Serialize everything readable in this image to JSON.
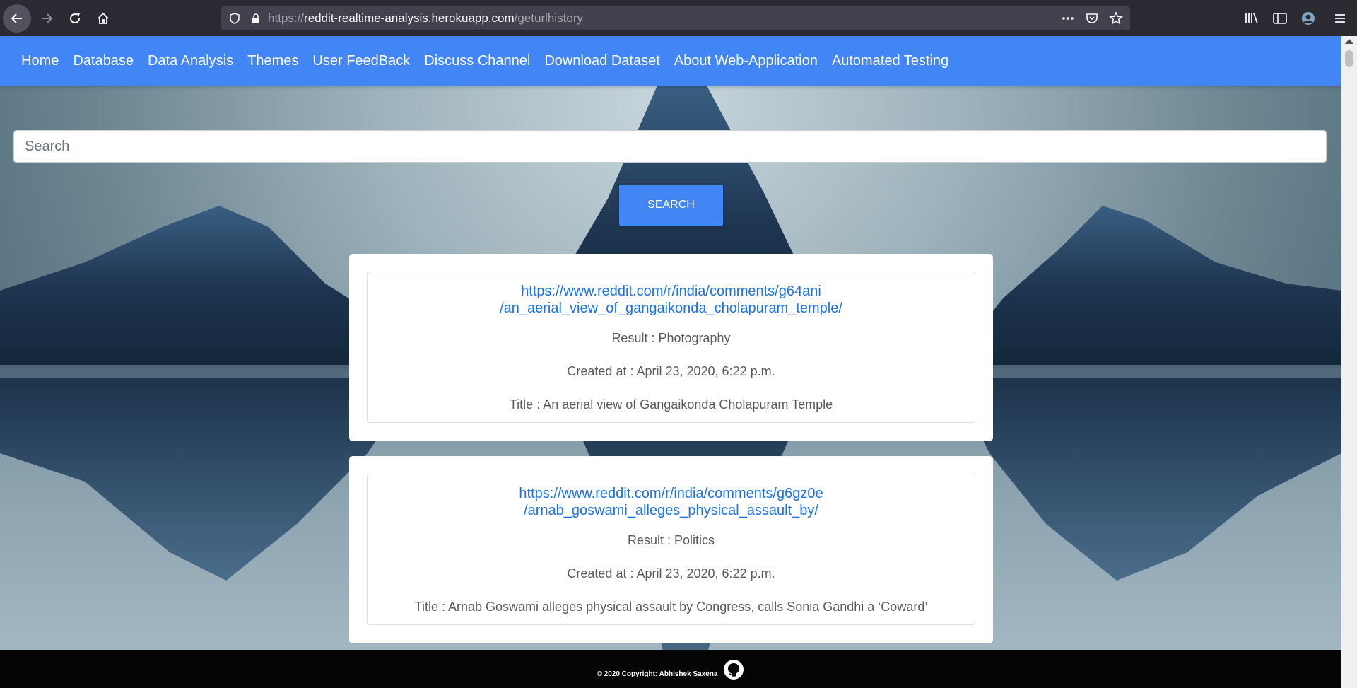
{
  "browser": {
    "url_protocol": "https://",
    "url_domain": "reddit-realtime-analysis.herokuapp.com",
    "url_path": "/geturlhistory"
  },
  "nav": {
    "items": [
      "Home",
      "Database",
      "Data Analysis",
      "Themes",
      "User FeedBack",
      "Discuss Channel",
      "Download Dataset",
      "About Web-Application",
      "Automated Testing"
    ]
  },
  "search": {
    "placeholder": "Search",
    "button_label": "SEARCH"
  },
  "results": [
    {
      "url_line1": "https://www.reddit.com/r/india/comments/g64ani",
      "url_line2": "/an_aerial_view_of_gangaikonda_cholapuram_temple/",
      "result": "Result : Photography",
      "created": "Created at : April 23, 2020, 6:22 p.m.",
      "title": "Title : An aerial view of Gangaikonda Cholapuram Temple"
    },
    {
      "url_line1": "https://www.reddit.com/r/india/comments/g6gz0e",
      "url_line2": "/arnab_goswami_alleges_physical_assault_by/",
      "result": "Result : Politics",
      "created": "Created at : April 23, 2020, 6:22 p.m.",
      "title": "Title : Arnab Goswami alleges physical assault by Congress, calls Sonia Gandhi a ‘Coward’"
    }
  ],
  "footer": {
    "copyright": "© 2020 Copyright: Abhishek Saxena"
  },
  "icons": [
    "back-icon",
    "forward-icon",
    "reload-icon",
    "home-icon",
    "shield-icon",
    "lock-icon",
    "more-icon",
    "pocket-icon",
    "bookmark-star-icon",
    "library-icon",
    "sidebar-icon",
    "account-icon",
    "menu-icon",
    "github-icon"
  ],
  "colors": {
    "navbar": "#4285f4",
    "link": "#1a73e8",
    "footer": "#050505"
  }
}
